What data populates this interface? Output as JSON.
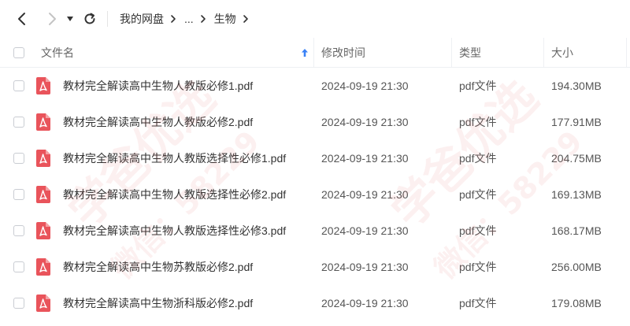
{
  "breadcrumb": {
    "root": "我的网盘",
    "ellipsis": "...",
    "current": "生物"
  },
  "columns": {
    "name": "文件名",
    "modified": "修改时间",
    "type": "类型",
    "size": "大小"
  },
  "files": [
    {
      "name": "教材完全解读高中生物人教版必修1.pdf",
      "modified": "2024-09-19 21:30",
      "type": "pdf文件",
      "size": "194.30MB"
    },
    {
      "name": "教材完全解读高中生物人教版必修2.pdf",
      "modified": "2024-09-19 21:30",
      "type": "pdf文件",
      "size": "177.91MB"
    },
    {
      "name": "教材完全解读高中生物人教版选择性必修1.pdf",
      "modified": "2024-09-19 21:30",
      "type": "pdf文件",
      "size": "204.75MB"
    },
    {
      "name": "教材完全解读高中生物人教版选择性必修2.pdf",
      "modified": "2024-09-19 21:30",
      "type": "pdf文件",
      "size": "169.13MB"
    },
    {
      "name": "教材完全解读高中生物人教版选择性必修3.pdf",
      "modified": "2024-09-19 21:30",
      "type": "pdf文件",
      "size": "168.17MB"
    },
    {
      "name": "教材完全解读高中生物苏教版必修2.pdf",
      "modified": "2024-09-19 21:30",
      "type": "pdf文件",
      "size": "256.00MB"
    },
    {
      "name": "教材完全解读高中生物浙科版必修2.pdf",
      "modified": "2024-09-19 21:30",
      "type": "pdf文件",
      "size": "179.08MB"
    }
  ],
  "watermark": {
    "text_main": "学爸优选",
    "text_sub": "微信：58229"
  },
  "colors": {
    "pdf_icon": "#e9545b",
    "sort_arrow": "#3b82f6",
    "watermark": "#e25a5a"
  },
  "icons": {
    "back": "chevron-left-icon",
    "forward": "chevron-right-icon",
    "dropdown": "caret-down-icon",
    "refresh": "refresh-icon",
    "sort": "sort-asc-icon",
    "file": "pdf-file-icon"
  }
}
